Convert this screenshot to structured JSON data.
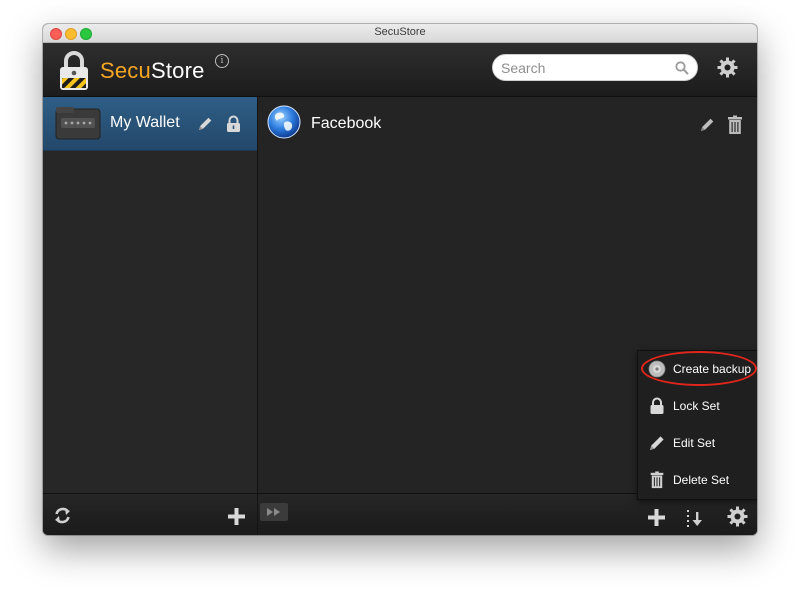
{
  "window": {
    "title": "SecuStore"
  },
  "header": {
    "app_name_accent": "Secu",
    "app_name_rest": "Store",
    "info_glyph": "i",
    "search": {
      "placeholder": "Search",
      "value": ""
    },
    "icons": {
      "logo": "padlock-logo-icon",
      "search": "search-icon",
      "settings": "gear-icon"
    }
  },
  "sidebar": {
    "items": [
      {
        "label": "My Wallet",
        "selected": true,
        "icons": [
          "wallet-icon",
          "pencil-icon",
          "lock-icon"
        ]
      }
    ],
    "footer": {
      "icons": [
        "sync-icon",
        "add-icon"
      ]
    }
  },
  "entries": [
    {
      "label": "Facebook",
      "icons": [
        "globe-icon",
        "pencil-icon",
        "trash-icon"
      ]
    }
  ],
  "footer": {
    "icons": [
      "forward-icon",
      "add-icon",
      "sort-icon",
      "gear-icon"
    ]
  },
  "context_menu": {
    "items": [
      {
        "label": "Create backup",
        "icon": "disc-icon",
        "highlighted": true
      },
      {
        "label": "Lock Set",
        "icon": "lock-icon"
      },
      {
        "label": "Edit Set",
        "icon": "pencil-icon"
      },
      {
        "label": "Delete Set",
        "icon": "trash-icon"
      }
    ]
  },
  "colors": {
    "accent": "#f6a623",
    "selection": "#2f5e86",
    "highlight_ring": "#e0251b",
    "background": "#242424"
  }
}
